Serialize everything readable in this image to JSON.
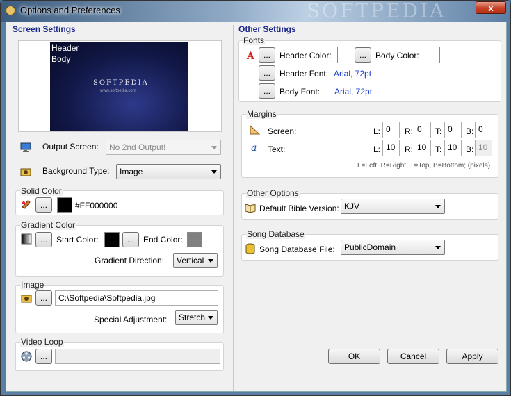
{
  "window": {
    "title": "Options and Preferences",
    "watermark": "SOFTPEDIA",
    "close": "x"
  },
  "screen_settings": {
    "heading": "Screen Settings",
    "preview": {
      "header": "Header",
      "body": "Body",
      "logo": "SOFTPEDIA",
      "url": "www.softpedia.com"
    },
    "output_screen": {
      "label": "Output Screen:",
      "value": "No 2nd Output!"
    },
    "background_type": {
      "label": "Background Type:",
      "value": "Image"
    },
    "solid_color": {
      "label": "Solid Color",
      "button": "...",
      "value": "#FF000000",
      "color": "#000000"
    },
    "gradient_color": {
      "label": "Gradient Color",
      "button": "...",
      "start_label": "Start Color:",
      "start_color": "#000000",
      "end_label": "End Color:",
      "end_color": "#808080",
      "direction_label": "Gradient Direction:",
      "direction_value": "Vertical"
    },
    "image": {
      "label": "Image",
      "button": "...",
      "path": "C:\\Softpedia\\Softpedia.jpg",
      "adjust_label": "Special Adjustment:",
      "adjust_value": "Stretch"
    },
    "video_loop": {
      "label": "Video Loop",
      "button": "...",
      "path": ""
    }
  },
  "other_settings": {
    "heading": "Other Settings",
    "fonts": {
      "label": "Fonts",
      "button": "...",
      "header_color_label": "Header Color:",
      "body_color_label": "Body Color:",
      "header_font_label": "Header Font:",
      "header_font_value": "Arial, 72pt",
      "body_font_label": "Body Font:",
      "body_font_value": "Arial, 72pt"
    },
    "margins": {
      "label": "Margins",
      "screen_label": "Screen:",
      "text_label": "Text:",
      "l": "L:",
      "r": "R:",
      "t": "T:",
      "b": "B:",
      "screen": {
        "l": "0",
        "r": "0",
        "t": "0",
        "b": "0"
      },
      "text": {
        "l": "10",
        "r": "10",
        "t": "10",
        "b": "10"
      },
      "hint": "L=Left, R=Right, T=Top, B=Bottom; (pixels)"
    },
    "other_options": {
      "label": "Other Options",
      "bible_label": "Default Bible Version:",
      "bible_value": "KJV"
    },
    "song_database": {
      "label": "Song Database",
      "file_label": "Song Database File:",
      "file_value": "PublicDomain"
    }
  },
  "buttons": {
    "ok": "OK",
    "cancel": "Cancel",
    "apply": "Apply"
  }
}
